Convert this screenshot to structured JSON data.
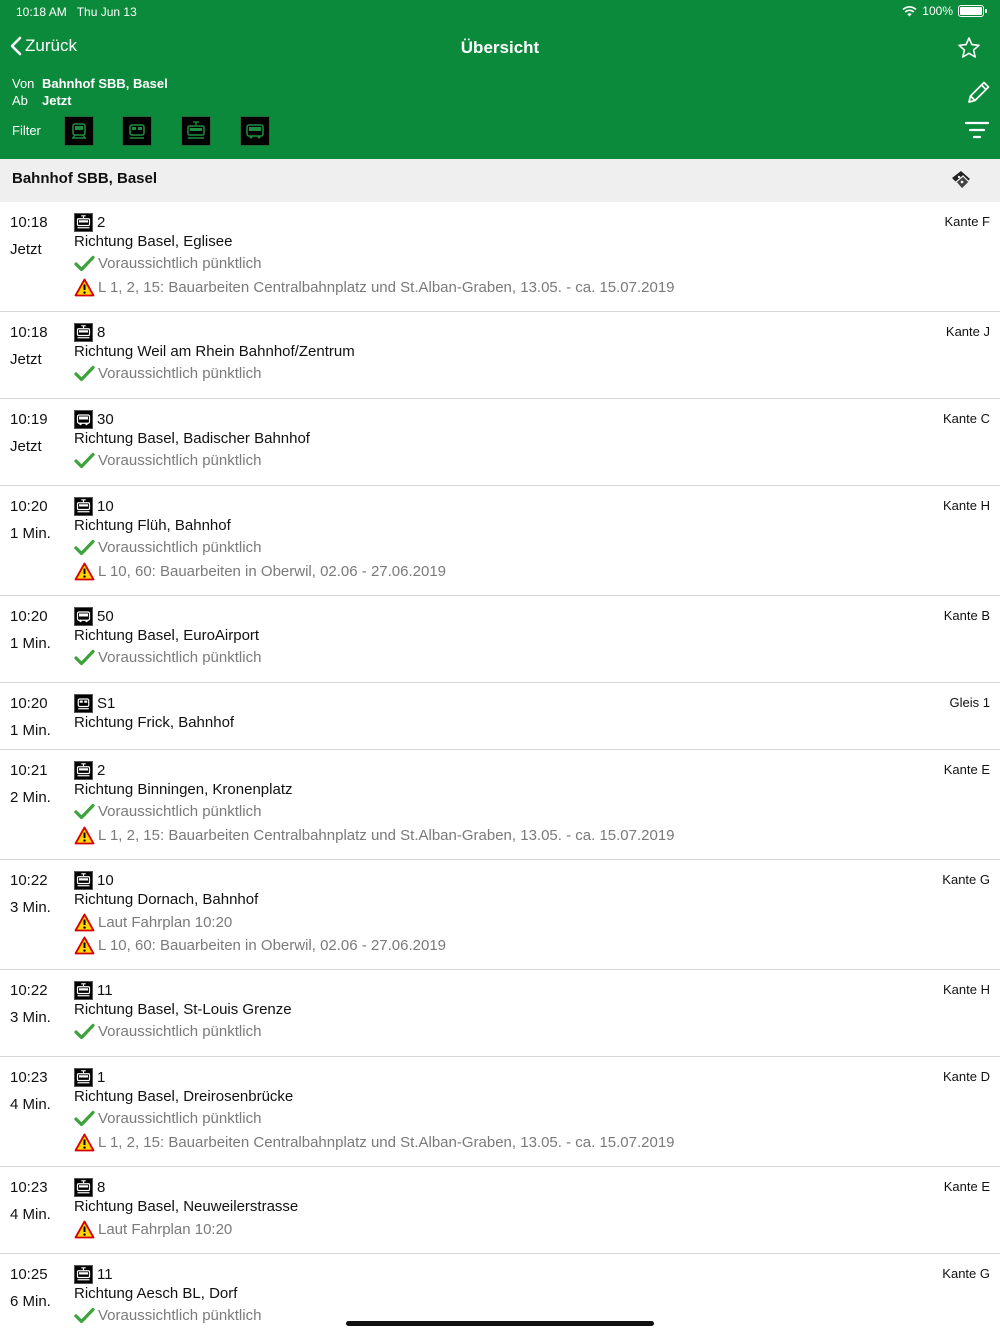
{
  "status_bar": {
    "time": "10:18 AM",
    "date": "Thu Jun 13",
    "battery": "100%"
  },
  "nav": {
    "back_label": "Zurück",
    "title": "Übersicht"
  },
  "query": {
    "from_label": "Von",
    "from_value": "Bahnhof SBB, Basel",
    "departure_label": "Ab",
    "departure_value": "Jetzt"
  },
  "filter": {
    "label": "Filter",
    "icons": [
      "train-icon",
      "regional-train-icon",
      "tram-icon",
      "bus-icon"
    ]
  },
  "section": {
    "title": "Bahnhof SBB, Basel",
    "icon": "tickets-icon"
  },
  "colors": {
    "header": "#0b8a3b",
    "check": "#3aa33a",
    "warning_fill": "#ffd600",
    "warning_border": "#d40000"
  },
  "departures": [
    {
      "time": "10:18",
      "relative": "Jetzt",
      "vehicle": "tram-icon",
      "line": "2",
      "direction": "Richtung Basel, Eglisee",
      "platform": "Kante F",
      "messages": [
        {
          "type": "check",
          "text": "Voraussichtlich pünktlich"
        },
        {
          "type": "warning",
          "text": "L 1, 2, 15: Bauarbeiten Centralbahnplatz und St.Alban-Graben, 13.05. - ca. 15.07.2019"
        }
      ]
    },
    {
      "time": "10:18",
      "relative": "Jetzt",
      "vehicle": "tram-icon",
      "line": "8",
      "direction": "Richtung Weil am Rhein Bahnhof/Zentrum",
      "platform": "Kante J",
      "messages": [
        {
          "type": "check",
          "text": "Voraussichtlich pünktlich"
        }
      ]
    },
    {
      "time": "10:19",
      "relative": "Jetzt",
      "vehicle": "bus-icon",
      "line": "30",
      "direction": "Richtung Basel, Badischer Bahnhof",
      "platform": "Kante C",
      "messages": [
        {
          "type": "check",
          "text": "Voraussichtlich pünktlich"
        }
      ]
    },
    {
      "time": "10:20",
      "relative": "1 Min.",
      "vehicle": "tram-icon",
      "line": "10",
      "direction": "Richtung Flüh, Bahnhof",
      "platform": "Kante H",
      "messages": [
        {
          "type": "check",
          "text": "Voraussichtlich pünktlich"
        },
        {
          "type": "warning",
          "text": "L 10, 60: Bauarbeiten in Oberwil, 02.06 - 27.06.2019"
        }
      ]
    },
    {
      "time": "10:20",
      "relative": "1 Min.",
      "vehicle": "bus-icon",
      "line": "50",
      "direction": "Richtung Basel, EuroAirport",
      "platform": "Kante B",
      "messages": [
        {
          "type": "check",
          "text": "Voraussichtlich pünktlich"
        }
      ]
    },
    {
      "time": "10:20",
      "relative": "1 Min.",
      "vehicle": "regional-train-icon",
      "line": "S1",
      "direction": "Richtung Frick, Bahnhof",
      "platform": "Gleis 1",
      "messages": []
    },
    {
      "time": "10:21",
      "relative": "2 Min.",
      "vehicle": "tram-icon",
      "line": "2",
      "direction": "Richtung Binningen, Kronenplatz",
      "platform": "Kante E",
      "messages": [
        {
          "type": "check",
          "text": "Voraussichtlich pünktlich"
        },
        {
          "type": "warning",
          "text": "L 1, 2, 15: Bauarbeiten Centralbahnplatz und St.Alban-Graben, 13.05. - ca. 15.07.2019"
        }
      ]
    },
    {
      "time": "10:22",
      "relative": "3 Min.",
      "vehicle": "tram-icon",
      "line": "10",
      "direction": "Richtung Dornach, Bahnhof",
      "platform": "Kante G",
      "messages": [
        {
          "type": "warning",
          "text": "Laut Fahrplan 10:20"
        },
        {
          "type": "warning",
          "text": "L 10, 60: Bauarbeiten in Oberwil, 02.06 - 27.06.2019"
        }
      ]
    },
    {
      "time": "10:22",
      "relative": "3 Min.",
      "vehicle": "tram-icon",
      "line": "11",
      "direction": "Richtung Basel, St-Louis Grenze",
      "platform": "Kante H",
      "messages": [
        {
          "type": "check",
          "text": "Voraussichtlich pünktlich"
        }
      ]
    },
    {
      "time": "10:23",
      "relative": "4 Min.",
      "vehicle": "tram-icon",
      "line": "1",
      "direction": "Richtung Basel, Dreirosenbrücke",
      "platform": "Kante D",
      "messages": [
        {
          "type": "check",
          "text": "Voraussichtlich pünktlich"
        },
        {
          "type": "warning",
          "text": "L 1, 2, 15: Bauarbeiten Centralbahnplatz und St.Alban-Graben, 13.05. - ca. 15.07.2019"
        }
      ]
    },
    {
      "time": "10:23",
      "relative": "4 Min.",
      "vehicle": "tram-icon",
      "line": "8",
      "direction": "Richtung Basel, Neuweilerstrasse",
      "platform": "Kante E",
      "messages": [
        {
          "type": "warning",
          "text": "Laut Fahrplan 10:20"
        }
      ]
    },
    {
      "time": "10:25",
      "relative": "6 Min.",
      "vehicle": "tram-icon",
      "line": "11",
      "direction": "Richtung Aesch BL, Dorf",
      "platform": "Kante G",
      "messages": [
        {
          "type": "check",
          "text": "Voraussichtlich pünktlich"
        }
      ]
    }
  ]
}
